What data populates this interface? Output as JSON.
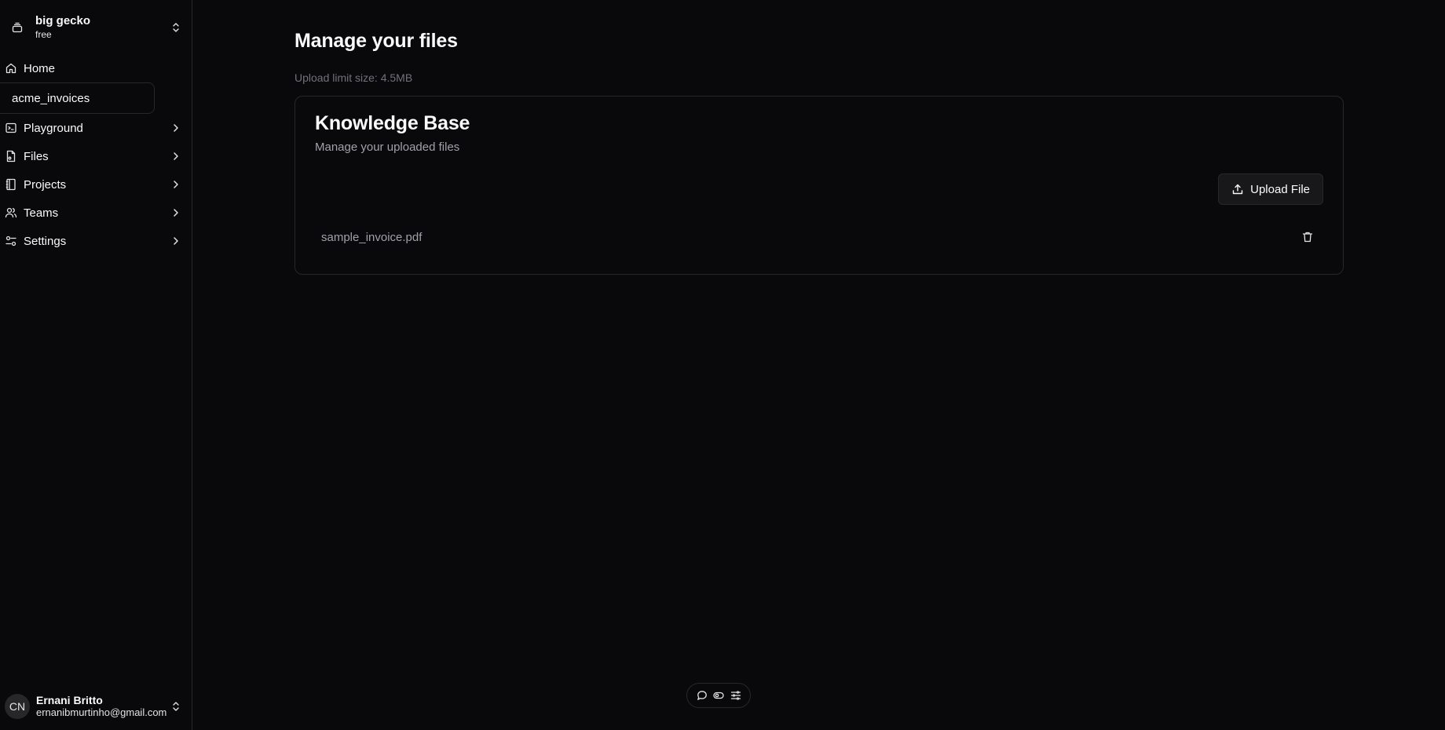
{
  "team": {
    "name": "big gecko",
    "plan": "free"
  },
  "sidebar": {
    "home_label": "Home",
    "project_label": "acme_invoices",
    "items": [
      {
        "label": "Playground",
        "icon": "terminal-square-icon"
      },
      {
        "label": "Files",
        "icon": "file-icon"
      },
      {
        "label": "Projects",
        "icon": "notebook-icon"
      },
      {
        "label": "Teams",
        "icon": "users-icon"
      },
      {
        "label": "Settings",
        "icon": "sliders-icon"
      }
    ]
  },
  "user": {
    "initials": "CN",
    "name": "Ernani Britto",
    "email": "ernanibmurtinho@gmail.com"
  },
  "main": {
    "title": "Manage your files",
    "upload_limit": "Upload limit size: 4.5MB",
    "card": {
      "title": "Knowledge Base",
      "description": "Manage your uploaded files",
      "upload_button": "Upload File",
      "files": [
        {
          "name": "sample_invoice.pdf"
        }
      ]
    }
  },
  "toolbar": {
    "icons": [
      "chat-bubble-icon",
      "toggle-icon",
      "settings-lines-icon"
    ]
  }
}
